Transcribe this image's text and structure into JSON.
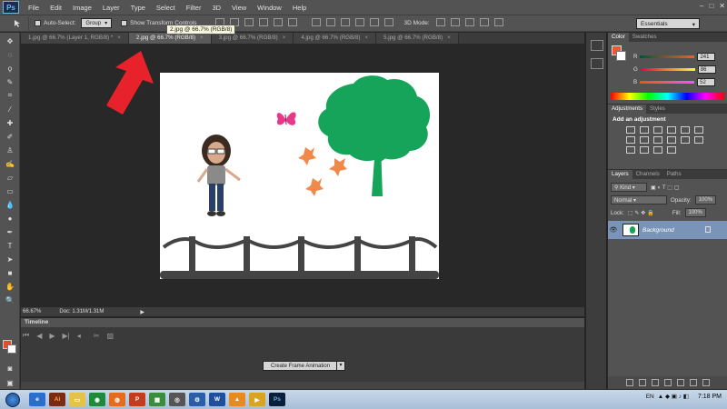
{
  "app": {
    "logo": "Ps"
  },
  "menu": [
    "File",
    "Edit",
    "Image",
    "Layer",
    "Type",
    "Select",
    "Filter",
    "3D",
    "View",
    "Window",
    "Help"
  ],
  "options": {
    "auto_select_label": "Auto-Select:",
    "auto_select_value": "Group",
    "transform_label": "Show Transform Controls",
    "mode_3d_label": "3D Mode:",
    "workspace": "Essentials"
  },
  "tooltip": "2.jpg @ 66.7% (RGB/8)",
  "tabs": [
    {
      "label": "1.jpg @ 66.7% (Layer 1, RGB/8) *",
      "active": false
    },
    {
      "label": "2.jpg @ 66.7% (RGB/8)",
      "active": true
    },
    {
      "label": "3.jpg @ 66.7% (RGB/8)",
      "active": false
    },
    {
      "label": "4.jpg @ 66.7% (RGB/8)",
      "active": false
    },
    {
      "label": "5.jpg @ 66.7% (RGB/8)",
      "active": false
    }
  ],
  "status": {
    "zoom": "66.67%",
    "doc": "Doc: 1.31M/1.31M"
  },
  "timeline": {
    "title": "Timeline",
    "button": "Create Frame Animation"
  },
  "color_panel": {
    "tabs": [
      "Color",
      "Swatches"
    ],
    "r_label": "R",
    "r_value": "241",
    "g_label": "G",
    "g_value": "86",
    "b_label": "B",
    "b_value": "52",
    "fg_color": "#f15634"
  },
  "adjustments": {
    "tabs": [
      "Adjustments",
      "Styles"
    ],
    "title": "Add an adjustment"
  },
  "layers": {
    "tabs": [
      "Layers",
      "Channels",
      "Paths"
    ],
    "kind": "Kind",
    "blend": "Normal",
    "opacity_label": "Opacity:",
    "opacity_value": "100%",
    "lock_label": "Lock:",
    "fill_label": "Fill:",
    "fill_value": "100%",
    "layer_name": "Background"
  },
  "taskbar": {
    "lang": "EN",
    "time": "7:18 PM"
  },
  "colors": {
    "tree": "#16a35a",
    "leaves": "#f08a4b",
    "butterfly": "#e8388a",
    "arrow": "#e8222b",
    "fence": "#444444"
  }
}
